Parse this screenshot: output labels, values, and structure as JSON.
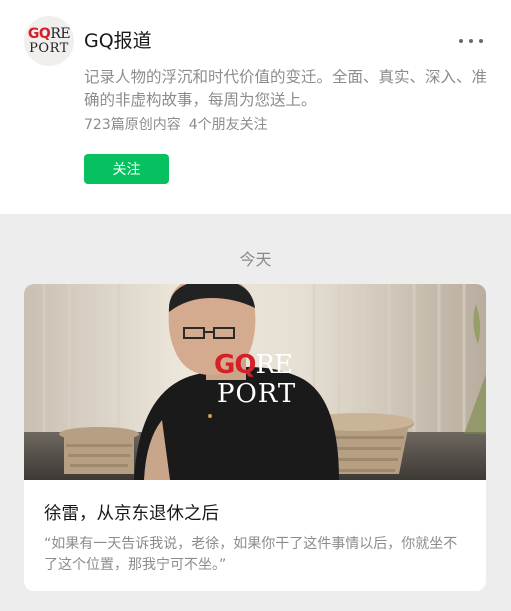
{
  "account": {
    "avatar_text_line1_gq": "GQ",
    "avatar_text_line1_re": "RE",
    "avatar_text_line2": "PORT",
    "name": "GQ报道",
    "description": "记录人物的浮沉和时代价值的变迁。全面、真实、深入、准确的非虚构故事，每周为您送上。",
    "original_count": "723篇原创内容",
    "friends_following": "4个朋友关注",
    "follow_label": "关注"
  },
  "feed": {
    "date_label": "今天",
    "articles": [
      {
        "cover_logo_gq": "GQ",
        "cover_logo_re": "RE",
        "cover_logo_port": "PORT",
        "title": "徐雷，从京东退休之后",
        "excerpt": "“如果有一天告诉我说，老徐，如果你干了这件事情以后，你就坐不了这个位置，那我宁可不坐。”"
      }
    ]
  },
  "colors": {
    "follow_button": "#07c160",
    "brand_red": "#d61f26",
    "page_background": "#ededed"
  }
}
